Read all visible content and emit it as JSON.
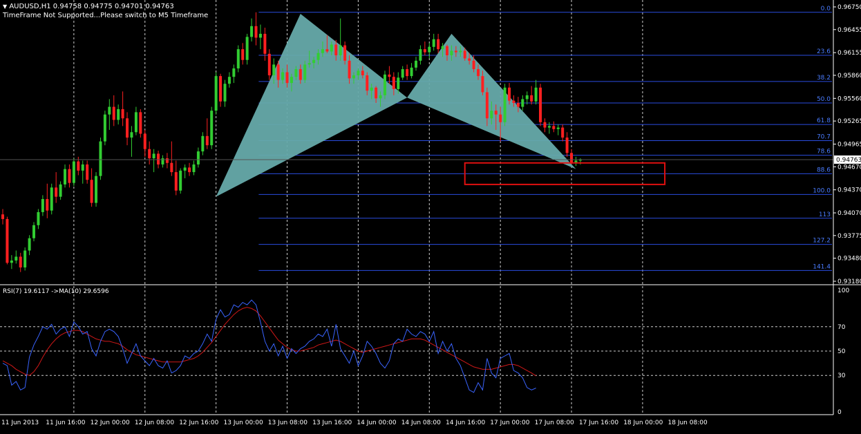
{
  "header": {
    "symbol_line": "AUDUSD,H1  0.94758 0.94775 0.94701 0.94763",
    "warning": "TimeFrame Not Supported...Please switch to M5 Timeframe",
    "rsi_label": "RSI(7) 19.6117  ->MA(10) 29.6596"
  },
  "colors": {
    "background": "#000000",
    "bull": "#32cd32",
    "bear": "#ff2020",
    "pattern_fill": "#66aaaa",
    "fib_line": "#2a4de0",
    "fib_label": "#4a7cff",
    "rsi_line": "#3a64ff",
    "ma_line": "#d01818",
    "box": "#e01010",
    "grid": "#d0d0d0"
  },
  "chart_data": [
    {
      "type": "candlestick",
      "symbol": "AUDUSD",
      "timeframe": "H1",
      "current_price": "0.94763",
      "ylim": [
        0.9318,
        0.9675
      ],
      "price_ticks": [
        "0.96750",
        "0.96455",
        "0.96155",
        "0.95860",
        "0.95560",
        "0.95265",
        "0.94965",
        "0.94670",
        "0.94370",
        "0.94070",
        "0.93775",
        "0.93480",
        "0.93180"
      ],
      "x_labels": [
        "11 Jun 2013",
        "11 Jun 16:00",
        "12 Jun 00:00",
        "12 Jun 08:00",
        "12 Jun 16:00",
        "13 Jun 00:00",
        "13 Jun 08:00",
        "13 Jun 16:00",
        "14 Jun 00:00",
        "14 Jun 08:00",
        "14 Jun 16:00",
        "17 Jun 00:00",
        "17 Jun 08:00",
        "17 Jun 16:00",
        "18 Jun 00:00",
        "18 Jun 08:00"
      ],
      "vertical_grid_bars": [
        16,
        32,
        48,
        64,
        80,
        96,
        112,
        128,
        144
      ],
      "candles": [
        [
          0.9405,
          0.9412,
          0.9392,
          0.9399
        ],
        [
          0.9399,
          0.9402,
          0.934,
          0.9342
        ],
        [
          0.9342,
          0.9352,
          0.9334,
          0.9345
        ],
        [
          0.9345,
          0.9358,
          0.9341,
          0.935
        ],
        [
          0.935,
          0.9355,
          0.933,
          0.9336
        ],
        [
          0.9336,
          0.9362,
          0.9332,
          0.9358
        ],
        [
          0.9358,
          0.9378,
          0.9352,
          0.9374
        ],
        [
          0.9374,
          0.9395,
          0.937,
          0.9391
        ],
        [
          0.9391,
          0.9412,
          0.9386,
          0.9408
        ],
        [
          0.9408,
          0.943,
          0.9403,
          0.9425
        ],
        [
          0.9425,
          0.9445,
          0.94,
          0.941
        ],
        [
          0.941,
          0.9445,
          0.9405,
          0.944
        ],
        [
          0.944,
          0.946,
          0.942,
          0.9428
        ],
        [
          0.9428,
          0.9448,
          0.9424,
          0.9444
        ],
        [
          0.9444,
          0.947,
          0.944,
          0.9464
        ],
        [
          0.9464,
          0.947,
          0.944,
          0.9446
        ],
        [
          0.9446,
          0.9478,
          0.9442,
          0.9474
        ],
        [
          0.9474,
          0.948,
          0.9456,
          0.9462
        ],
        [
          0.9462,
          0.9475,
          0.9445,
          0.947
        ],
        [
          0.947,
          0.9475,
          0.9445,
          0.945
        ],
        [
          0.945,
          0.9465,
          0.9415,
          0.942
        ],
        [
          0.942,
          0.946,
          0.9415,
          0.9455
        ],
        [
          0.9455,
          0.9505,
          0.945,
          0.95
        ],
        [
          0.95,
          0.954,
          0.9495,
          0.9535
        ],
        [
          0.9535,
          0.9555,
          0.9515,
          0.9545
        ],
        [
          0.9545,
          0.956,
          0.952,
          0.9528
        ],
        [
          0.9528,
          0.9548,
          0.9522,
          0.9542
        ],
        [
          0.9542,
          0.9565,
          0.952,
          0.953
        ],
        [
          0.953,
          0.9538,
          0.9495,
          0.9505
        ],
        [
          0.9505,
          0.952,
          0.948,
          0.9512
        ],
        [
          0.9512,
          0.9545,
          0.9508,
          0.9538
        ],
        [
          0.9538,
          0.9542,
          0.9505,
          0.951
        ],
        [
          0.951,
          0.9515,
          0.948,
          0.949
        ],
        [
          0.949,
          0.95,
          0.947,
          0.9478
        ],
        [
          0.9478,
          0.949,
          0.946,
          0.9484
        ],
        [
          0.9484,
          0.9488,
          0.9465,
          0.947
        ],
        [
          0.947,
          0.9482,
          0.9466,
          0.9478
        ],
        [
          0.9478,
          0.9485,
          0.9465,
          0.9472
        ],
        [
          0.9472,
          0.95,
          0.9455,
          0.946
        ],
        [
          0.946,
          0.9475,
          0.943,
          0.9436
        ],
        [
          0.9436,
          0.9465,
          0.9432,
          0.9462
        ],
        [
          0.9462,
          0.947,
          0.9452,
          0.9466
        ],
        [
          0.9466,
          0.9472,
          0.9455,
          0.946
        ],
        [
          0.946,
          0.9475,
          0.9456,
          0.947
        ],
        [
          0.947,
          0.9492,
          0.9466,
          0.9487
        ],
        [
          0.9487,
          0.9512,
          0.9482,
          0.9507
        ],
        [
          0.9507,
          0.953,
          0.949,
          0.9495
        ],
        [
          0.9495,
          0.9545,
          0.949,
          0.954
        ],
        [
          0.954,
          0.959,
          0.9535,
          0.9585
        ],
        [
          0.9585,
          0.9588,
          0.9545,
          0.9552
        ],
        [
          0.9552,
          0.958,
          0.9545,
          0.9575
        ],
        [
          0.9575,
          0.959,
          0.957,
          0.9584
        ],
        [
          0.9584,
          0.96,
          0.9576,
          0.9595
        ],
        [
          0.9595,
          0.9625,
          0.959,
          0.962
        ],
        [
          0.962,
          0.9628,
          0.96,
          0.9606
        ],
        [
          0.9606,
          0.964,
          0.96,
          0.9636
        ],
        [
          0.9636,
          0.966,
          0.963,
          0.965
        ],
        [
          0.965,
          0.9668,
          0.9625,
          0.9635
        ],
        [
          0.9635,
          0.9652,
          0.962,
          0.964
        ],
        [
          0.964,
          0.9648,
          0.9605,
          0.9614
        ],
        [
          0.9614,
          0.962,
          0.958,
          0.9586
        ],
        [
          0.9586,
          0.9608,
          0.9575,
          0.96
        ],
        [
          0.96,
          0.9605,
          0.957,
          0.958
        ],
        [
          0.958,
          0.9595,
          0.9575,
          0.959
        ],
        [
          0.959,
          0.96,
          0.957,
          0.9576
        ],
        [
          0.9576,
          0.9588,
          0.9565,
          0.9584
        ],
        [
          0.9584,
          0.9598,
          0.958,
          0.9594
        ],
        [
          0.9594,
          0.96,
          0.9575,
          0.958
        ],
        [
          0.958,
          0.9605,
          0.9576,
          0.96
        ],
        [
          0.96,
          0.9618,
          0.9596,
          0.9602
        ],
        [
          0.9602,
          0.961,
          0.9595,
          0.9606
        ],
        [
          0.9606,
          0.962,
          0.96,
          0.9615
        ],
        [
          0.9615,
          0.963,
          0.961,
          0.962
        ],
        [
          0.962,
          0.9638,
          0.9615,
          0.9617
        ],
        [
          0.9617,
          0.963,
          0.9612,
          0.9626
        ],
        [
          0.9626,
          0.9632,
          0.9605,
          0.9612
        ],
        [
          0.9612,
          0.966,
          0.9605,
          0.9625
        ],
        [
          0.9625,
          0.963,
          0.96,
          0.9605
        ],
        [
          0.9605,
          0.9612,
          0.9575,
          0.9582
        ],
        [
          0.9582,
          0.959,
          0.9575,
          0.9586
        ],
        [
          0.9586,
          0.9595,
          0.958,
          0.9592
        ],
        [
          0.9592,
          0.9598,
          0.9582,
          0.9586
        ],
        [
          0.9586,
          0.959,
          0.956,
          0.9566
        ],
        [
          0.9566,
          0.9575,
          0.9555,
          0.957
        ],
        [
          0.957,
          0.9572,
          0.955,
          0.9556
        ],
        [
          0.9556,
          0.9565,
          0.9545,
          0.956
        ],
        [
          0.956,
          0.9592,
          0.9555,
          0.9587
        ],
        [
          0.9587,
          0.9598,
          0.9575,
          0.9584
        ],
        [
          0.9584,
          0.959,
          0.956,
          0.9568
        ],
        [
          0.9568,
          0.959,
          0.9562,
          0.9583
        ],
        [
          0.9583,
          0.9598,
          0.958,
          0.9594
        ],
        [
          0.9594,
          0.96,
          0.958,
          0.9585
        ],
        [
          0.9585,
          0.9602,
          0.9582,
          0.9596
        ],
        [
          0.9596,
          0.961,
          0.9592,
          0.9605
        ],
        [
          0.9605,
          0.9625,
          0.96,
          0.962
        ],
        [
          0.962,
          0.963,
          0.9612,
          0.9616
        ],
        [
          0.9616,
          0.9628,
          0.9608,
          0.9623
        ],
        [
          0.9623,
          0.964,
          0.9618,
          0.9633
        ],
        [
          0.9633,
          0.964,
          0.9615,
          0.962
        ],
        [
          0.962,
          0.9628,
          0.961,
          0.9624
        ],
        [
          0.9624,
          0.9626,
          0.9605,
          0.9612
        ],
        [
          0.9612,
          0.9625,
          0.9605,
          0.9618
        ],
        [
          0.9618,
          0.9624,
          0.961,
          0.9616
        ],
        [
          0.9616,
          0.9624,
          0.961,
          0.9618
        ],
        [
          0.9618,
          0.9622,
          0.9605,
          0.9608
        ],
        [
          0.9608,
          0.9615,
          0.96,
          0.9605
        ],
        [
          0.9605,
          0.9612,
          0.959,
          0.9594
        ],
        [
          0.9594,
          0.96,
          0.958,
          0.9585
        ],
        [
          0.9585,
          0.9592,
          0.956,
          0.9564
        ],
        [
          0.9564,
          0.957,
          0.952,
          0.953
        ],
        [
          0.953,
          0.9552,
          0.9522,
          0.954
        ],
        [
          0.954,
          0.9548,
          0.9515,
          0.9535
        ],
        [
          0.9535,
          0.9545,
          0.95,
          0.9525
        ],
        [
          0.9525,
          0.9575,
          0.952,
          0.957
        ],
        [
          0.957,
          0.9576,
          0.9548,
          0.9553
        ],
        [
          0.9553,
          0.956,
          0.9545,
          0.955
        ],
        [
          0.955,
          0.9558,
          0.9538,
          0.9545
        ],
        [
          0.9545,
          0.956,
          0.954,
          0.9555
        ],
        [
          0.9555,
          0.9565,
          0.9548,
          0.956
        ],
        [
          0.956,
          0.9572,
          0.9548,
          0.9552
        ],
        [
          0.9552,
          0.958,
          0.9548,
          0.957
        ],
        [
          0.957,
          0.9575,
          0.952,
          0.9525
        ],
        [
          0.9525,
          0.953,
          0.9512,
          0.9518
        ],
        [
          0.9518,
          0.9525,
          0.951,
          0.952
        ],
        [
          0.952,
          0.9526,
          0.9512,
          0.9516
        ],
        [
          0.9516,
          0.9522,
          0.9508,
          0.9518
        ],
        [
          0.9518,
          0.9522,
          0.95,
          0.9505
        ],
        [
          0.9505,
          0.9512,
          0.948,
          0.9485
        ],
        [
          0.9485,
          0.949,
          0.947,
          0.9472
        ],
        [
          0.9472,
          0.948,
          0.9468,
          0.9475
        ],
        [
          0.9475,
          0.9478,
          0.947,
          0.9476
        ]
      ],
      "pattern": {
        "name": "butterfly",
        "points": [
          {
            "bar": 48,
            "price": 0.9428
          },
          {
            "bar": 67,
            "price": 0.9666
          },
          {
            "bar": 91,
            "price": 0.9557
          },
          {
            "bar": 101,
            "price": 0.964
          },
          {
            "bar": 129,
            "price": 0.9464
          }
        ]
      },
      "fib_levels": [
        {
          "label": "0.0",
          "price": 0.9668
        },
        {
          "label": "23.6",
          "price": 0.9612
        },
        {
          "label": "38.2",
          "price": 0.9578
        },
        {
          "label": "50.0",
          "price": 0.955
        },
        {
          "label": "61.8",
          "price": 0.9522
        },
        {
          "label": "70.7",
          "price": 0.9501
        },
        {
          "label": "78.6",
          "price": 0.9482
        },
        {
          "label": "88.6",
          "price": 0.9458
        },
        {
          "label": "100.0",
          "price": 0.9431
        },
        {
          "label": "113",
          "price": 0.94
        },
        {
          "label": "127.2",
          "price": 0.9366
        },
        {
          "label": "141.4",
          "price": 0.9332
        }
      ],
      "target_zone": {
        "bar_start": 104,
        "bar_end": 149,
        "price_top": 0.9472,
        "price_bottom": 0.9444
      }
    },
    {
      "type": "line",
      "title": "RSI(7) 19.6117  ->MA(10) 29.6596",
      "ylim": [
        0,
        100
      ],
      "y_ticks": [
        "100",
        "70",
        "50",
        "30",
        "0"
      ],
      "levels": [
        70,
        50,
        30
      ],
      "series": [
        {
          "name": "RSI(7)",
          "values": [
            40,
            38,
            22,
            25,
            18,
            20,
            45,
            55,
            62,
            70,
            68,
            72,
            64,
            68,
            70,
            62,
            74,
            70,
            64,
            66,
            52,
            46,
            58,
            66,
            68,
            66,
            62,
            52,
            40,
            48,
            56,
            46,
            42,
            38,
            44,
            38,
            36,
            42,
            32,
            34,
            38,
            46,
            44,
            48,
            50,
            56,
            64,
            58,
            76,
            84,
            78,
            80,
            88,
            86,
            90,
            88,
            92,
            88,
            74,
            58,
            50,
            56,
            46,
            54,
            44,
            52,
            48,
            52,
            54,
            58,
            60,
            64,
            62,
            68,
            54,
            72,
            52,
            46,
            40,
            50,
            38,
            46,
            58,
            54,
            48,
            40,
            36,
            42,
            56,
            60,
            58,
            68,
            64,
            62,
            66,
            64,
            58,
            66,
            48,
            58,
            50,
            56,
            44,
            38,
            28,
            18,
            16,
            24,
            18,
            44,
            32,
            28,
            44,
            46,
            48,
            34,
            32,
            28,
            20,
            18,
            19.6
          ]
        },
        {
          "name": "MA(10)",
          "values": [
            42,
            40,
            38,
            35,
            33,
            31,
            30,
            33,
            38,
            45,
            51,
            56,
            60,
            63,
            65,
            66,
            67,
            67,
            66,
            64,
            62,
            60,
            59,
            58,
            58,
            57,
            56,
            54,
            51,
            49,
            47,
            46,
            45,
            44,
            43,
            42,
            41,
            41,
            41,
            41,
            41,
            42,
            43,
            44,
            46,
            49,
            53,
            57,
            62,
            67,
            72,
            76,
            80,
            83,
            85,
            86,
            85,
            83,
            79,
            74,
            69,
            64,
            59,
            56,
            53,
            51,
            50,
            50,
            51,
            52,
            53,
            55,
            56,
            57,
            58,
            59,
            58,
            56,
            54,
            52,
            50,
            49,
            50,
            51,
            52,
            53,
            54,
            55,
            56,
            57,
            58,
            59,
            60,
            60,
            60,
            59,
            57,
            55,
            53,
            51,
            49,
            47,
            45,
            43,
            41,
            39,
            37,
            36,
            35,
            35,
            35,
            36,
            37,
            38,
            39,
            39,
            38,
            36,
            34,
            32,
            29.6
          ]
        }
      ]
    }
  ]
}
